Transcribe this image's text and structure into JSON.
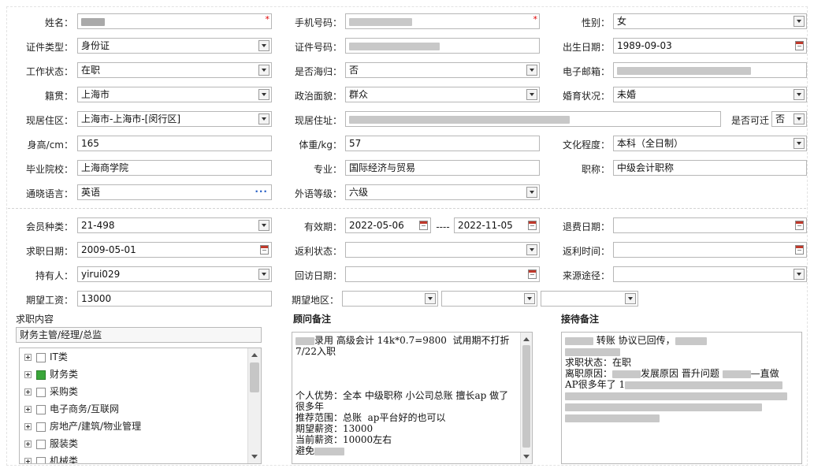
{
  "fields": {
    "name": {
      "label": "姓名："
    },
    "phone": {
      "label": "手机号码："
    },
    "gender": {
      "label": "性别：",
      "value": "女"
    },
    "id_type": {
      "label": "证件类型：",
      "value": "身份证"
    },
    "id_number": {
      "label": "证件号码："
    },
    "birth_date": {
      "label": "出生日期：",
      "value": "1989-09-03"
    },
    "work_status": {
      "label": "工作状态：",
      "value": "在职"
    },
    "returnee": {
      "label": "是否海归：",
      "value": "否"
    },
    "email": {
      "label": "电子邮箱："
    },
    "native_place": {
      "label": "籍贯：",
      "value": "上海市"
    },
    "political": {
      "label": "政治面貌：",
      "value": "群众"
    },
    "marital": {
      "label": "婚育状况：",
      "value": "未婚"
    },
    "current_area": {
      "label": "现居住区：",
      "value": "上海市-上海市-[闵行区]"
    },
    "current_address": {
      "label": "现居住址："
    },
    "relocate": {
      "label": "是否可迁",
      "value": "否"
    },
    "height": {
      "label": "身高/cm：",
      "value": "165"
    },
    "weight": {
      "label": "体重/kg：",
      "value": "57"
    },
    "education": {
      "label": "文化程度：",
      "value": "本科（全日制）"
    },
    "school": {
      "label": "毕业院校：",
      "value": "上海商学院"
    },
    "major": {
      "label": "专业：",
      "value": "国际经济与贸易"
    },
    "title": {
      "label": "职称：",
      "value": "中级会计职称"
    },
    "language": {
      "label": "通晓语言：",
      "value": "英语"
    },
    "foreign_level": {
      "label": "外语等级：",
      "value": "六级"
    },
    "member_type": {
      "label": "会员种类：",
      "value": "21-498"
    },
    "valid_period": {
      "label": "有效期：",
      "start": "2022-05-06",
      "sep": "----",
      "end": "2022-11-05"
    },
    "refund_date": {
      "label": "退费日期："
    },
    "job_date": {
      "label": "求职日期：",
      "value": "2009-05-01"
    },
    "rebate_status": {
      "label": "返利状态："
    },
    "rebate_time": {
      "label": "返利时间："
    },
    "holder": {
      "label": "持有人：",
      "value": "yirui029"
    },
    "visit_date": {
      "label": "回访日期："
    },
    "source": {
      "label": "来源途径："
    },
    "salary": {
      "label": "期望工资：",
      "value": "13000"
    },
    "region": {
      "label": "期望地区："
    }
  },
  "job_content": {
    "title": "求职内容",
    "selected": "财务主管/经理/总监",
    "tree": [
      {
        "label": "IT类",
        "checked": false
      },
      {
        "label": "财务类",
        "checked": true
      },
      {
        "label": "采购类",
        "checked": false
      },
      {
        "label": "电子商务/互联网",
        "checked": false
      },
      {
        "label": "房地产/建筑/物业管理",
        "checked": false
      },
      {
        "label": "服装类",
        "checked": false
      },
      {
        "label": "机械类",
        "checked": false
      }
    ]
  },
  "consultant_notes": {
    "title": "顾问备注",
    "line1": "录用 高级会计 14k*0.7=9800  试用期不打折",
    "line2": "7/22入职",
    "line3": "个人优势：全本 中级职称 小公司总账 擅长ap 做了",
    "line4": "很多年",
    "line5": "推荐范围：总账  ap平台好的也可以",
    "line6": "期望薪资：13000",
    "line7": "当前薪资：10000左右",
    "line8": "避免"
  },
  "reception_notes": {
    "title": "接待备注",
    "line1a": "转账 协议已回传，",
    "line2": "求职状态：在职",
    "line3a": "离职原因：",
    "line3b": "发展原因 晋升问题",
    "line3c": "—直做",
    "line4a": "AP很多年了 1"
  }
}
